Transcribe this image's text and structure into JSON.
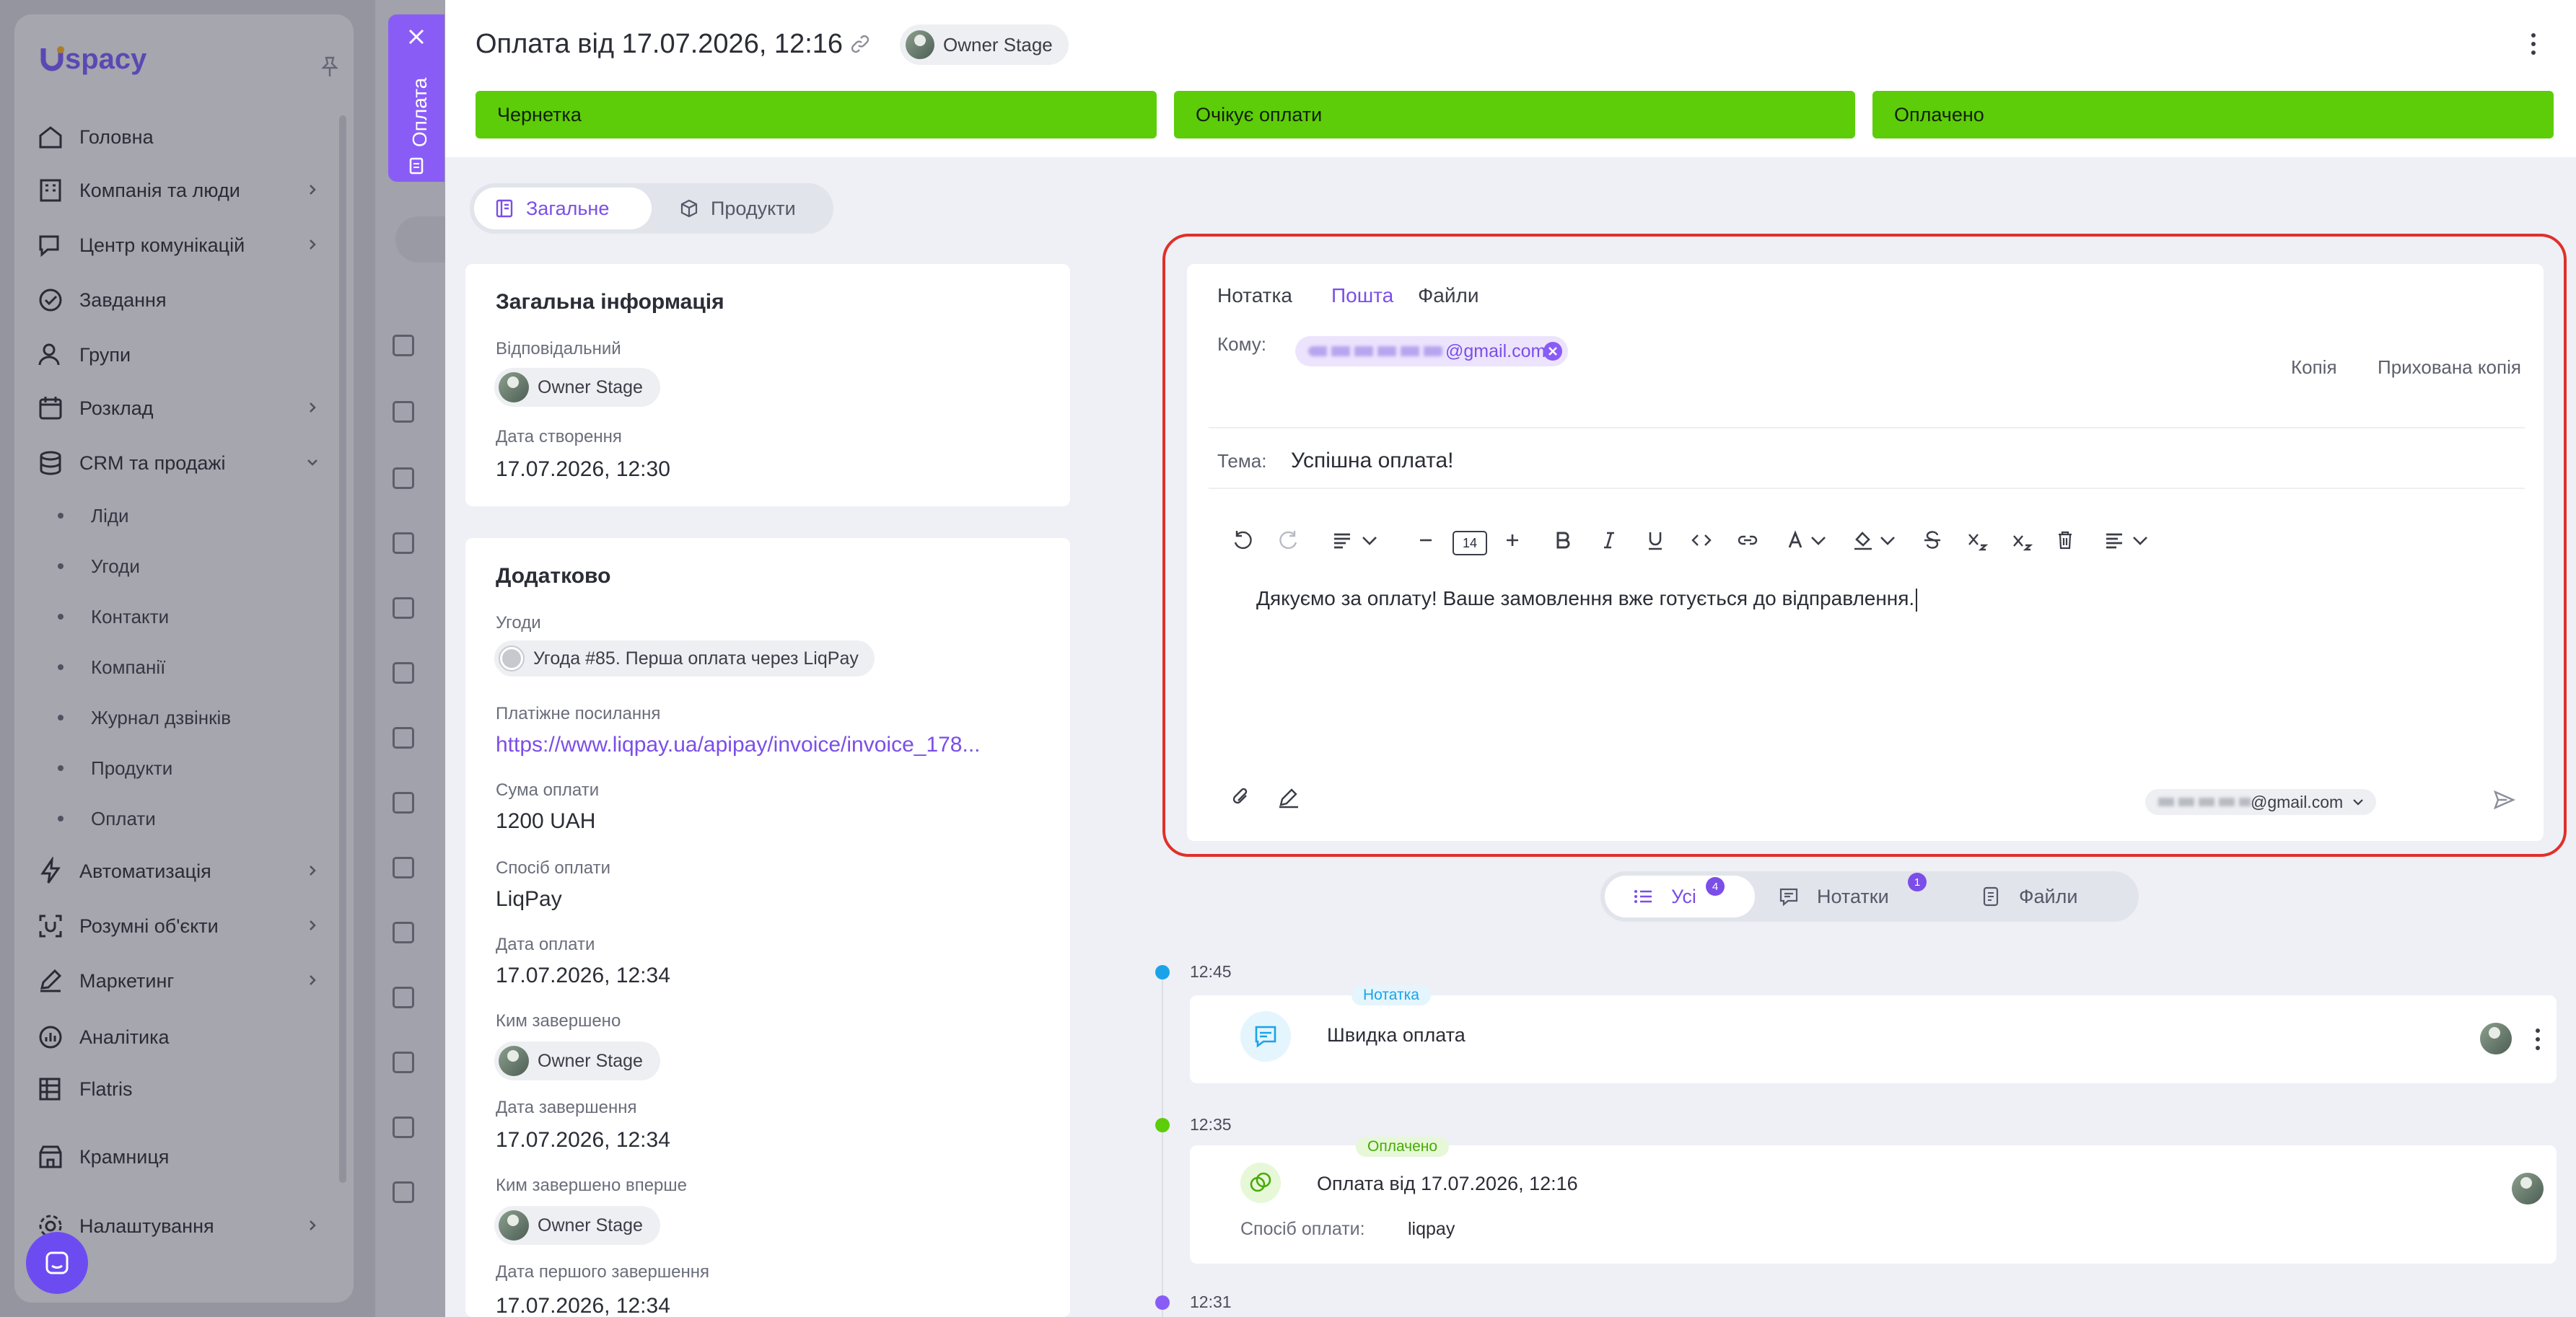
{
  "app": {
    "logo": "spacy"
  },
  "sidebar": {
    "items": [
      {
        "label": "Головна"
      },
      {
        "label": "Компанія та люди"
      },
      {
        "label": "Центр комунікацій"
      },
      {
        "label": "Завдання"
      },
      {
        "label": "Групи"
      },
      {
        "label": "Розклад"
      },
      {
        "label": "CRM та продажі"
      },
      {
        "label": "Автоматизація"
      },
      {
        "label": "Розумні об'єкти"
      },
      {
        "label": "Маркетинг"
      },
      {
        "label": "Аналітика"
      },
      {
        "label": "Flatris"
      },
      {
        "label": "Крамниця"
      },
      {
        "label": "Налаштування"
      }
    ],
    "crm_sub": [
      {
        "label": "Ліди"
      },
      {
        "label": "Угоди"
      },
      {
        "label": "Контакти"
      },
      {
        "label": "Компанії"
      },
      {
        "label": "Журнал дзвінків"
      },
      {
        "label": "Продукти"
      },
      {
        "label": "Оплати"
      }
    ]
  },
  "side_tab": {
    "label": "Оплата"
  },
  "header": {
    "title": "Оплата від 17.07.2026, 12:16",
    "owner": "Owner Stage",
    "stages": [
      "Чернетка",
      "Очікує оплати",
      "Оплачено"
    ]
  },
  "tabs": {
    "general": "Загальне",
    "products": "Продукти"
  },
  "general_info": {
    "title": "Загальна інформація",
    "responsible_label": "Відповідальний",
    "responsible": "Owner Stage",
    "created_label": "Дата створення",
    "created": "17.07.2026, 12:30"
  },
  "additional": {
    "title": "Додатково",
    "deals_label": "Угоди",
    "deal": "Угода #85. Перша оплата через LiqPay",
    "paylink_label": "Платіжне посилання",
    "paylink": "https://www.liqpay.ua/apipay/invoice/invoice_178...",
    "amount_label": "Сума оплати",
    "amount": "1200 UAH",
    "method_label": "Спосіб оплати",
    "method": "LiqPay",
    "paydate_label": "Дата оплати",
    "paydate": "17.07.2026, 12:34",
    "completed_by_label": "Ким завершено",
    "completed_by": "Owner Stage",
    "completed_date_label": "Дата завершення",
    "completed_date": "17.07.2026, 12:34",
    "first_completed_by_label": "Ким завершено вперше",
    "first_completed_by": "Owner Stage",
    "first_completed_date_label": "Дата першого завершення",
    "first_completed_date": "17.07.2026, 12:34"
  },
  "composer": {
    "tabs": [
      "Нотатка",
      "Пошта",
      "Файли"
    ],
    "to_label": "Кому:",
    "to_email": "@gmail.com",
    "cc": "Копія",
    "bcc": "Прихована копія",
    "subject_label": "Тема:",
    "subject": "Успішна оплата!",
    "font_size": "14",
    "body": "Дякуємо за оплату! Ваше замовлення вже готується до відправлення.",
    "from_email": "@gmail.com"
  },
  "filters": {
    "all": "Усі",
    "all_count": "4",
    "notes": "Нотатки",
    "notes_count": "1",
    "files": "Файли"
  },
  "timeline": [
    {
      "time": "12:45",
      "tag": "Нотатка",
      "title": "Швидка оплата",
      "color": "#1aa3e8"
    },
    {
      "time": "12:35",
      "tag": "Оплачено",
      "title": "Оплата від 17.07.2026, 12:16",
      "detail_label": "Спосіб оплати:",
      "detail_value": "liqpay",
      "color": "#5ccd08"
    },
    {
      "time": "12:31",
      "color": "#8a5cf6"
    }
  ],
  "colors": {
    "accent": "#7b4ee8",
    "stage": "#5ccd08",
    "highlight": "#e0302a"
  }
}
